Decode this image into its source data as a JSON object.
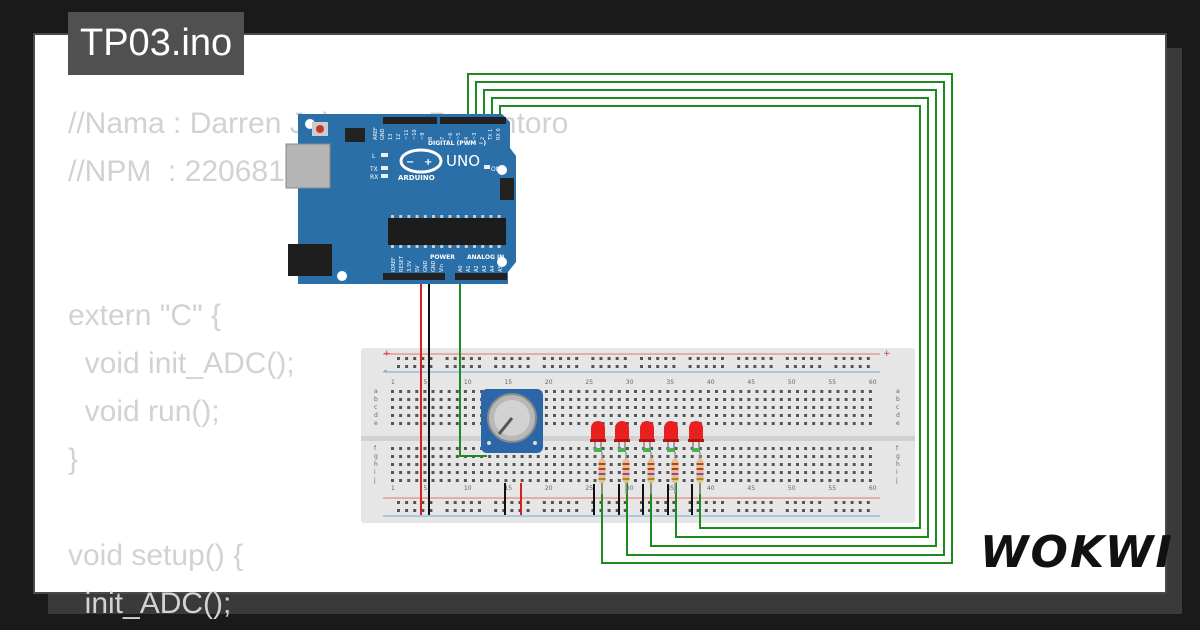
{
  "title": "TP03.ino",
  "code_lines": [
    "//Nama : Darren Johannes Pratantoro",
    "//NPM  : 2206810",
    "",
    "",
    "extern \"C\" {",
    "  void init_ADC();",
    "  void run();",
    "}",
    "",
    "void setup() {",
    "  init_ADC();"
  ],
  "brand": "WOKWI",
  "arduino": {
    "model": "UNO",
    "brand": "ARDUINO",
    "digital_label": "DIGITAL (PWM ~)",
    "power_label": "POWER",
    "analog_label": "ANALOG IN",
    "on_label": "ON",
    "tx_label": "TX",
    "rx_label": "RX",
    "l_label": "L",
    "aref_label": "AREF",
    "gnd_label": "GND",
    "digital_pins": [
      "13",
      "12",
      "~11",
      "~10",
      "~9",
      "8",
      "7",
      "~6",
      "~5",
      "4",
      "~3",
      "2",
      "TX 1",
      "RX 0"
    ],
    "power_pins": [
      "IOREF",
      "RESET",
      "3.3V",
      "5V",
      "GND",
      "GND",
      "Vin"
    ],
    "analog_pins": [
      "A0",
      "A1",
      "A2",
      "A3",
      "A4",
      "A5"
    ]
  },
  "breadboard": {
    "column_numbers": [
      "1",
      "5",
      "10",
      "15",
      "20",
      "25",
      "30",
      "35",
      "40",
      "45",
      "50",
      "55",
      "60"
    ],
    "row_letters_top": [
      "a",
      "b",
      "c",
      "d",
      "e"
    ],
    "row_letters_bottom": [
      "f",
      "g",
      "h",
      "i",
      "j"
    ],
    "rail_plus": "+",
    "rail_minus": "-"
  },
  "colors": {
    "arduino_board": "#2a6fa8",
    "wire_green": "#1d8a1d",
    "wire_red": "#d81e1e",
    "wire_black": "#111111",
    "led": "#e82020",
    "breadboard": "#e6e6e6",
    "background": "#1a1a1a"
  },
  "components": {
    "led_count": 5,
    "resistor_count": 5,
    "potentiometer_count": 1
  }
}
